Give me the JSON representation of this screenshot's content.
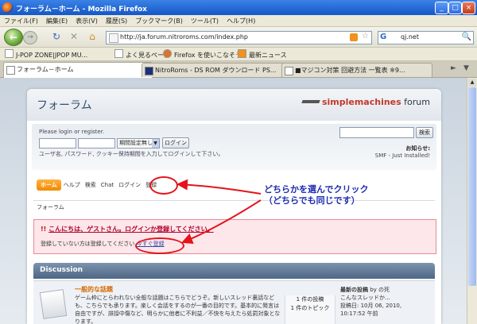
{
  "window": {
    "title": "フォーラム－ホーム - Mozilla Firefox",
    "minimize": "_",
    "maximize": "□",
    "close": "×"
  },
  "menu": [
    "ファイル(F)",
    "編集(E)",
    "表示(V)",
    "履歴(S)",
    "ブックマーク(B)",
    "ツール(T)",
    "ヘルプ(H)"
  ],
  "nav": {
    "url": "http://ja.forum.nitroroms.com/index.php",
    "search_engine": "G",
    "search_value": "qj.net"
  },
  "bookmarks": [
    "J-POP ZONE|JPOP MU...",
    "よく見るページ",
    "Firefox を使いこなそう",
    "最新ニュース"
  ],
  "tabs": [
    {
      "label": "フォーラム－ホーム",
      "active": true
    },
    {
      "label": "NitroRoms - DS ROM ダウンロード PS...",
      "active": false
    },
    {
      "label": "■マジコン対策 回避方法 一覧表 ※9...",
      "active": false
    }
  ],
  "forum": {
    "title": "フォーラム",
    "logo_brand": "simplemachines",
    "logo_suffix": " forum",
    "login_prompt": "Please login or register.",
    "session_select": "期間設定無し",
    "login_button": "ログイン",
    "login_hint": "ユーザ名, パスワード, クッキー保持期間を入力してログインして下さい。",
    "search_button": "検索",
    "news_label": "お知らせ:",
    "news_text": "SMF - Just Installed!",
    "mainmenu": {
      "home": "ホーム",
      "help": "ヘルプ",
      "search": "検索",
      "chat": "Chat",
      "login": "ログイン",
      "register": "登録"
    },
    "linktree": "フォーラム",
    "notice": {
      "mark": "!!",
      "heading": "こんにちは、ゲストさん。ログインか登録してください。",
      "body": "登録していない方は登録してください",
      "link": "今すぐ登録"
    },
    "category": "Discussion",
    "board": {
      "name": "一般的な話題",
      "description": "ゲーム枠にとらわれない全般な話題はこちらでどうぞ。新しいスレッド裏話なども、こちらでも承ります。楽しく会話をするのが一番の目的です。基本的に発言は自由ですが、誹謗中傷など、明らかに他者に不利益／不快を与えたら処罰対象となります。",
      "posts": "1 件の投稿",
      "topics": "1 件のトピック",
      "last_post_label": "最新の投稿",
      "last_post_by": "by の死",
      "last_post_subject": "こんなスレッドか...",
      "last_post_date": "投稿日: 10月 06, 2010,",
      "last_post_time": "10:17:52 午前"
    }
  },
  "annotation": {
    "line1": "どちらかを選んでクリック",
    "line2": "（どちらでも同じです）",
    "color": "#e4141a"
  }
}
